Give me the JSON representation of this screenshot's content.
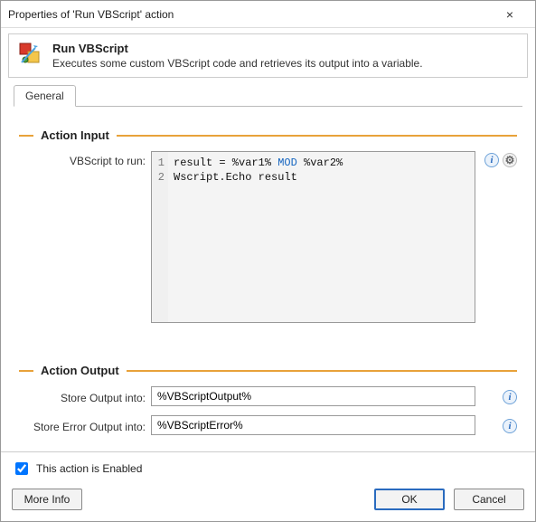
{
  "window": {
    "title": "Properties of 'Run VBScript' action",
    "close_symbol": "×"
  },
  "header": {
    "title": "Run VBScript",
    "subtitle": "Executes some custom VBScript code and retrieves its output into a variable."
  },
  "tabs": {
    "general": "General"
  },
  "sections": {
    "input_title": "Action Input",
    "output_title": "Action Output"
  },
  "labels": {
    "vbscript_to_run": "VBScript to run:",
    "store_output": "Store Output into:",
    "store_error": "Store Error Output into:"
  },
  "code": {
    "line1_prefix": "result = %var1% ",
    "line1_kw": "MOD",
    "line1_suffix": " %var2%",
    "line2": "Wscript.Echo result",
    "gutter": [
      "1",
      "2"
    ]
  },
  "fields": {
    "output_value": "%VBScriptOutput%",
    "error_value": "%VBScriptError%"
  },
  "footer": {
    "enabled_label": "This action is Enabled",
    "enabled_checked": true,
    "more_info": "More Info",
    "ok": "OK",
    "cancel": "Cancel"
  },
  "icons": {
    "info_glyph": "i",
    "gear_glyph": "⚙"
  }
}
